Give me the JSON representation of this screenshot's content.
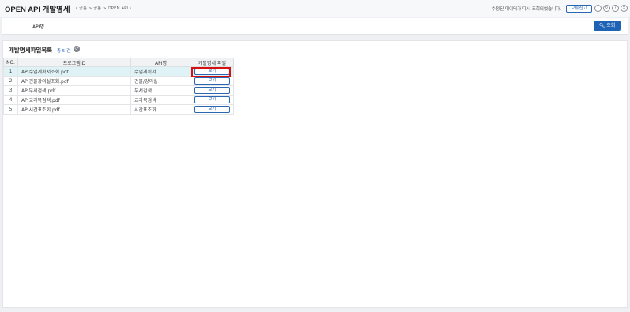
{
  "header": {
    "title": "OPEN API 개발명세",
    "breadcrumb": "( 공통 > 공통 > OPEN API )",
    "notice": "수정된 데이터가 다시 조회되었습니다.",
    "report_label": "오류신고",
    "icons": [
      "back-icon",
      "refresh-icon",
      "help-icon",
      "close-icon"
    ]
  },
  "search": {
    "api_label": "API명",
    "button_label": "조회"
  },
  "list": {
    "title": "개발명세파일목록",
    "count": "총 5 건",
    "columns": [
      "NO.",
      "프로그램ID",
      "API명",
      "개발명세 파일"
    ],
    "rows": [
      {
        "no": "1",
        "program_id": "API수업계획서조회.pdf",
        "api_name": "수업계획서",
        "file_label": "보기"
      },
      {
        "no": "2",
        "program_id": "API건물강의실조회.pdf",
        "api_name": "건물/강의실",
        "file_label": "보기"
      },
      {
        "no": "3",
        "program_id": "API부서검색.pdf",
        "api_name": "부서검색",
        "file_label": "보기"
      },
      {
        "no": "4",
        "program_id": "API교과목검색.pdf",
        "api_name": "교과목검색",
        "file_label": "보기"
      },
      {
        "no": "5",
        "program_id": "API시간표조회.pdf",
        "api_name": "시간표조회",
        "file_label": "보기"
      }
    ]
  },
  "colors": {
    "accent": "#1f63b5",
    "selected_row": "#dff2f6",
    "highlight": "#d60f0f"
  }
}
